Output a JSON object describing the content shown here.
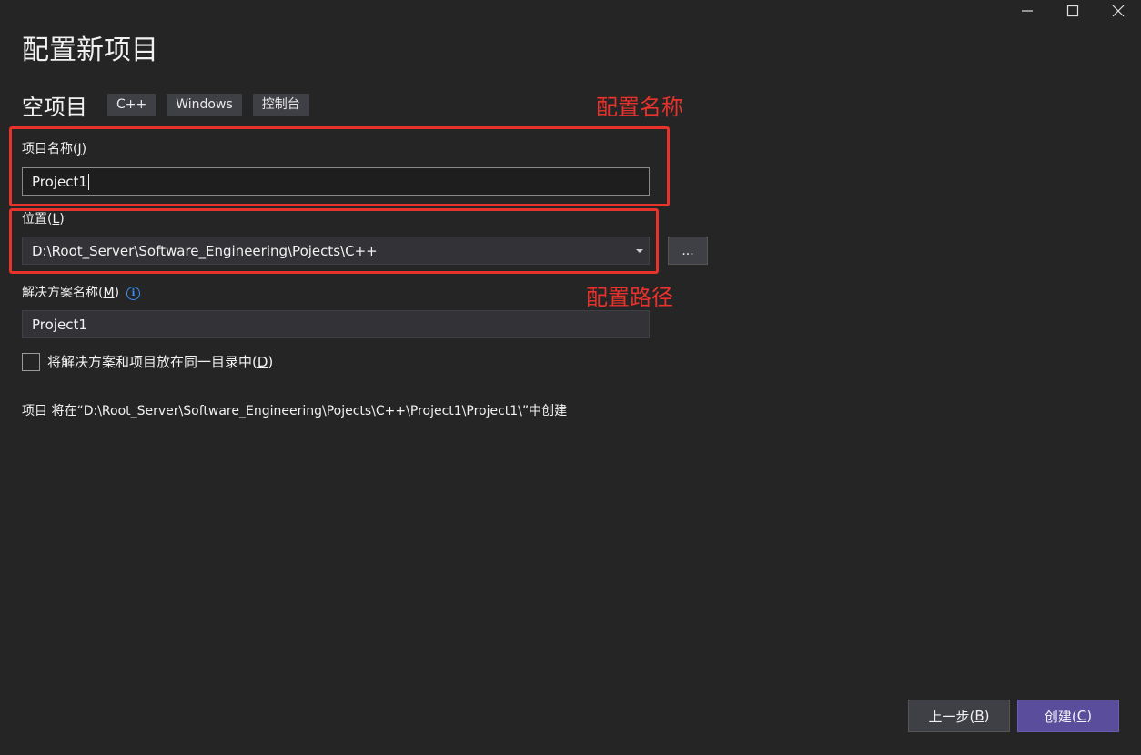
{
  "window": {
    "minimize_glyph": "—",
    "maximize_icon": "maximize-icon",
    "close_icon": "close-icon"
  },
  "page": {
    "title": "配置新项目"
  },
  "template": {
    "name": "空项目",
    "tags": [
      "C++",
      "Windows",
      "控制台"
    ]
  },
  "project_name": {
    "label_prefix": "项目名称(",
    "label_key": "J",
    "label_suffix": ")",
    "value": "Project1"
  },
  "location": {
    "label_prefix": "位置(",
    "label_key": "L",
    "label_suffix": ")",
    "value": "D:\\Root_Server\\Software_Engineering\\Pojects\\C++",
    "browse_label": "..."
  },
  "solution_name": {
    "label_prefix": "解决方案名称(",
    "label_key": "M",
    "label_suffix": ")",
    "value": "Project1",
    "info_icon": "info-icon"
  },
  "same_dir": {
    "label_prefix": "将解决方案和项目放在同一目录中(",
    "label_key": "D",
    "label_suffix": ")",
    "checked": false
  },
  "summary": {
    "text": "项目 将在“D:\\Root_Server\\Software_Engineering\\Pojects\\C++\\Project1\\Project1\\”中创建"
  },
  "annotations": {
    "name_note": "配置名称",
    "path_note": "配置路径",
    "color": "#e8322c"
  },
  "footer": {
    "back_prefix": "上一步(",
    "back_key": "B",
    "back_suffix": ")",
    "create_prefix": "创建(",
    "create_key": "C",
    "create_suffix": ")"
  },
  "colors": {
    "background": "#252526",
    "accent": "#5a4d9c",
    "info": "#3794ff"
  }
}
